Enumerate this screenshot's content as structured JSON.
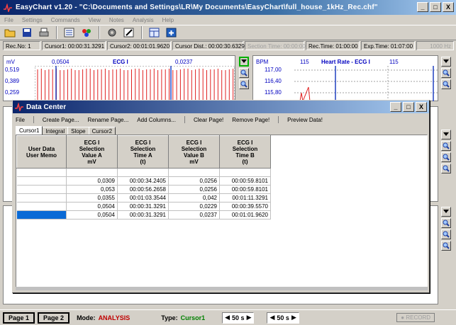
{
  "window": {
    "title": "EasyChart v1.20  -  \"C:\\Documents and Settings\\LR\\My Documents\\EasyChart\\full_house_1kHz_Rec.chf\"",
    "minimize": "_",
    "maximize": "□",
    "close": "X"
  },
  "menu": [
    "File",
    "Settings",
    "Commands",
    "View",
    "Notes",
    "Analysis",
    "Help"
  ],
  "status": {
    "rec_no": "Rec.No: 1",
    "cursor1": "Cursor1: 00:00:31.3291",
    "cursor2": "Cursor2: 00:01:01.9620",
    "cursor_dist": "Cursor Dist.: 00:00:30.6329",
    "section_time": "Section Time: 00:00:00",
    "rec_time": "Rec.Time: 01:00:00",
    "exp_time": "Exp.Time: 01:07:00",
    "freq": "1000 Hz"
  },
  "charts": {
    "left": {
      "unit": "mV",
      "cursor_a": "0,0504",
      "name": "ECG I",
      "cursor_b": "0,0237",
      "yticks": [
        "0,519",
        "0,389",
        "0,259"
      ]
    },
    "right": {
      "unit": "BPM",
      "cursor_a": "115",
      "name": "Heart Rate - ECG I",
      "cursor_b": "115",
      "yticks": [
        "117,00",
        "116,40",
        "115,80"
      ]
    }
  },
  "dialog": {
    "title": "Data Center",
    "menu": [
      "File",
      "Create Page...",
      "Rename Page...",
      "Add Columns...",
      "Clear Page!",
      "Remove Page!",
      "Preview Data!"
    ],
    "tabs": [
      "Cursor1",
      "Integral",
      "Slope",
      "Cursor2"
    ],
    "columns": [
      [
        "User Data",
        "User Memo"
      ],
      [
        "ECG I",
        "Selection",
        "Value A",
        "mV"
      ],
      [
        "ECG I",
        "Selection",
        "Time A",
        "(t)"
      ],
      [
        "ECG I",
        "Selection",
        "Value B",
        "mV"
      ],
      [
        "ECG I",
        "Selection",
        "Time B",
        "(t)"
      ]
    ],
    "rows": [
      [
        "",
        "",
        "",
        "",
        ""
      ],
      [
        "",
        "0,0309",
        "00:00:34.2405",
        "0,0256",
        "00:00:59.8101"
      ],
      [
        "",
        "0,053",
        "00:00:56.2658",
        "0,0256",
        "00:00:59.8101"
      ],
      [
        "",
        "0,0355",
        "00:01:03.3544",
        "0,042",
        "00:01:11.3291"
      ],
      [
        "",
        "0,0504",
        "00:00:31.3291",
        "0,0229",
        "00:00:39.5570"
      ],
      [
        "",
        "0,0504",
        "00:00:31.3291",
        "0,0237",
        "00:01:01.9620"
      ]
    ]
  },
  "bottom": {
    "page1": "Page 1",
    "page2": "Page 2",
    "mode_label": "Mode:",
    "mode_value": "ANALYSIS",
    "type_label": "Type:",
    "type_value": "Cursor1",
    "combo1": "50 s",
    "combo2": "50 s",
    "record": "RECORD"
  }
}
